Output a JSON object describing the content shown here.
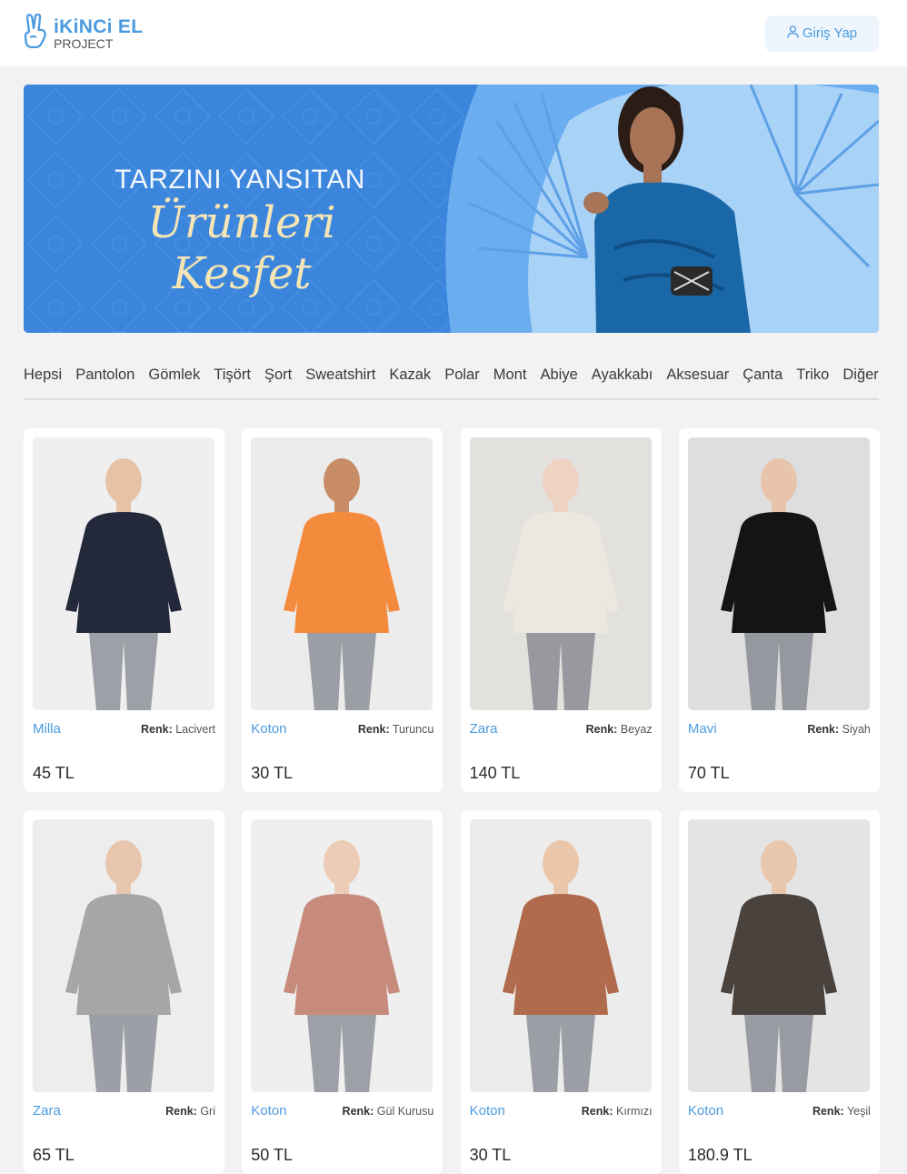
{
  "header": {
    "logo_title": "iKiNCi EL",
    "logo_subtitle": "PROJECT",
    "login_label": "Giriş Yap",
    "logo_icon": "hand-peace-icon",
    "login_icon": "user-icon"
  },
  "banner": {
    "line1": "TARZINI YANSITAN",
    "line2": "Ürünleri Kesfet"
  },
  "categories": [
    "Hepsi",
    "Pantolon",
    "Gömlek",
    "Tişört",
    "Şort",
    "Sweatshirt",
    "Kazak",
    "Polar",
    "Mont",
    "Abiye",
    "Ayakkabı",
    "Aksesuar",
    "Çanta",
    "Triko",
    "Diğer"
  ],
  "color_label": "Renk:",
  "products": [
    {
      "brand": "Milla",
      "color": "Lacivert",
      "price": "45 TL",
      "garment": "#23283a",
      "bg": "#efefef",
      "skin": "#e6c2a6"
    },
    {
      "brand": "Koton",
      "color": "Turuncu",
      "price": "30 TL",
      "garment": "#f48a3c",
      "bg": "#ececec",
      "skin": "#c88c66"
    },
    {
      "brand": "Zara",
      "color": "Beyaz",
      "price": "140 TL",
      "garment": "#ece8df",
      "bg": "#e3e1de",
      "skin": "#efd3c2"
    },
    {
      "brand": "Mavi",
      "color": "Siyah",
      "price": "70 TL",
      "garment": "#141414",
      "bg": "#dedede",
      "skin": "#e7c4aa"
    },
    {
      "brand": "Zara",
      "color": "Gri",
      "price": "65 TL",
      "garment": "#a6a6a6",
      "bg": "#ededed",
      "skin": "#e8c6ae"
    },
    {
      "brand": "Koton",
      "color": "Gül Kurusu",
      "price": "50 TL",
      "garment": "#c78b7c",
      "bg": "#efefef",
      "skin": "#ecccb6"
    },
    {
      "brand": "Koton",
      "color": "Kırmızı",
      "price": "30 TL",
      "garment": "#b06a4c",
      "bg": "#ececec",
      "skin": "#eac6aa"
    },
    {
      "brand": "Koton",
      "color": "Yeşil",
      "price": "180.9 TL",
      "garment": "#4a423d",
      "bg": "#e4e4e4",
      "skin": "#e9c7ac"
    }
  ]
}
